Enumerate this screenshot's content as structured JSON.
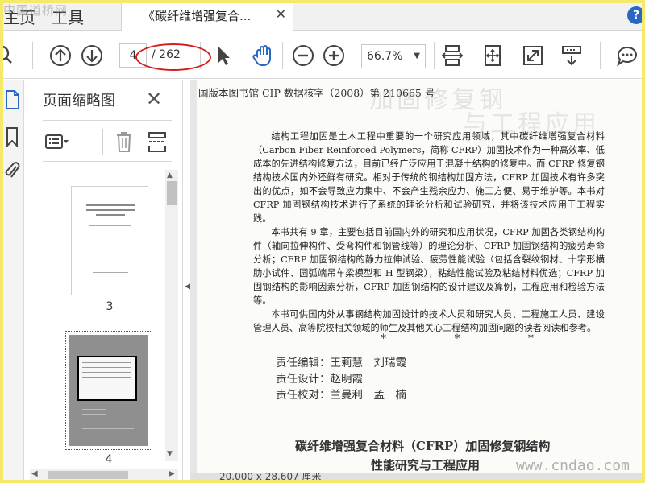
{
  "watermark_top": "中国道桥网",
  "tabs": {
    "home": "主页",
    "tools": "工具",
    "document_title": "《碳纤维增强复合...",
    "close_symbol": "✕"
  },
  "help_symbol": "?",
  "toolbar": {
    "page_current": "4",
    "page_total": "/ 262",
    "zoom": "66.7%",
    "icons": [
      "search-icon",
      "page-up-icon",
      "page-down-icon",
      "select-cursor-icon",
      "hand-tool-icon",
      "zoom-out-icon",
      "zoom-in-icon",
      "fit-width-icon",
      "fit-page-icon",
      "fullscreen-icon",
      "scroll-mode-icon",
      "comment-icon"
    ],
    "accent_color": "#2a66c4"
  },
  "left_rail": {
    "icons": [
      "page-thumbnails-icon",
      "bookmark-icon",
      "attachment-icon"
    ]
  },
  "thumb_panel": {
    "title": "页面缩略图",
    "close_symbol": "✕",
    "tool_icons": [
      "thumbnail-options-icon",
      "delete-page-icon",
      "extract-page-icon"
    ],
    "thumbnails": [
      {
        "label": "3"
      },
      {
        "label": "4"
      }
    ]
  },
  "document": {
    "bleed_title_1": "加固修复钢",
    "bleed_title_2": "与工程应用",
    "cip": "国版本图书馆 CIP 数据核字（2008）第 210665 号",
    "paragraphs": [
      "结构工程加固是土木工程中重要的一个研究应用领域，其中碳纤维增强复合材料（Carbon Fiber Reinforced Polymers，简称 CFRP）加固技术作为一种高效率、低成本的先进结构修复方法，目前已经广泛应用于混凝土结构的修复中。而 CFRP 修复钢结构技术国内外还鲜有研究。相对于传统的钢结构加固方法，CFRP 加固技术有许多突出的优点，如不会导致应力集中、不会产生残余应力、施工方便、易于维护等。本书对 CFRP 加固钢结构技术进行了系统的理论分析和试验研究，并将该技术应用于工程实践。",
      "本书共有 9 章，主要包括目前国内外的研究和应用状况，CFRP 加固各类钢结构构件（轴向拉伸构件、受弯构件和钢管线等）的理论分析、CFRP 加固钢结构的疲劳寿命分析；CFRP 加固钢结构的静力拉伸试验、疲劳性能试验（包括含裂纹钢材、十字形横肋小试件、圆弧端吊车梁模型和 H 型钢梁），粘结性能试验及粘结材料优选；CFRP 加固钢结构的影响因素分析，CFRP 加固钢结构的设计建议及算例，工程应用和检验方法等。",
      "本书可供国内外从事钢结构加固设计的技术人员和研究人员、工程施工人员、建设管理人员、高等院校相关领域的师生及其他关心工程结构加固问题的读者阅读和参考。"
    ],
    "stars": "* * *",
    "credits": [
      "责任编辑：王莉慧　刘瑞霞",
      "责任设计：赵明霞",
      "责任校对：兰曼利　孟　楠"
    ],
    "footer_title_1": "碳纤维增强复合材料（CFRP）加固修复钢结构",
    "footer_title_2": "性能研究与工程应用"
  },
  "status": {
    "text": "20.000 x 28.607 厘米"
  },
  "watermark_br": "www.cndao.com"
}
